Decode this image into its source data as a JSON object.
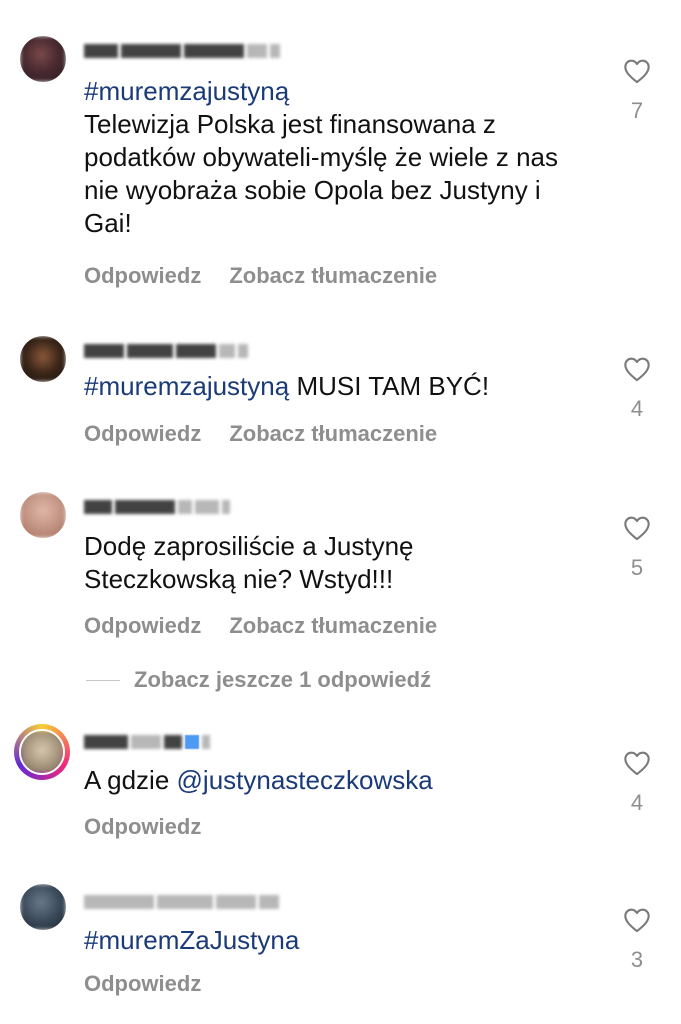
{
  "colors": {
    "text": "#111111",
    "link": "#1b3a78",
    "muted": "#8e8e8e"
  },
  "icons": {
    "like": "heart-outline-icon"
  },
  "comments": [
    {
      "hashtag": "#muremzajustyną",
      "text": "Telewizja Polska jest finansowana z podatków obywateli-myślę że wiele z nas nie wyobraża sobie Opola bez Justyny i Gai!",
      "reply_label": "Odpowiedz",
      "translate_label": "Zobacz tłumaczenie",
      "likes": "7"
    },
    {
      "hashtag": "#muremzajustyną",
      "text": "MUSI TAM BYĆ!",
      "reply_label": "Odpowiedz",
      "translate_label": "Zobacz tłumaczenie",
      "likes": "4"
    },
    {
      "text_line1": "Dodę zaprosiliście a Justynę",
      "text_line2": "Steczkowską nie? Wstyd!!!",
      "reply_label": "Odpowiedz",
      "translate_label": "Zobacz tłumaczenie",
      "likes": "5"
    },
    {
      "prefix": "A gdzie",
      "mention": "@justynasteczkowska",
      "reply_label": "Odpowiedz",
      "likes": "4"
    },
    {
      "hashtag": "#muremZaJustyna",
      "reply_label": "Odpowiedz",
      "likes": "3"
    }
  ],
  "more_replies_label": "Zobacz jeszcze 1 odpowiedź"
}
